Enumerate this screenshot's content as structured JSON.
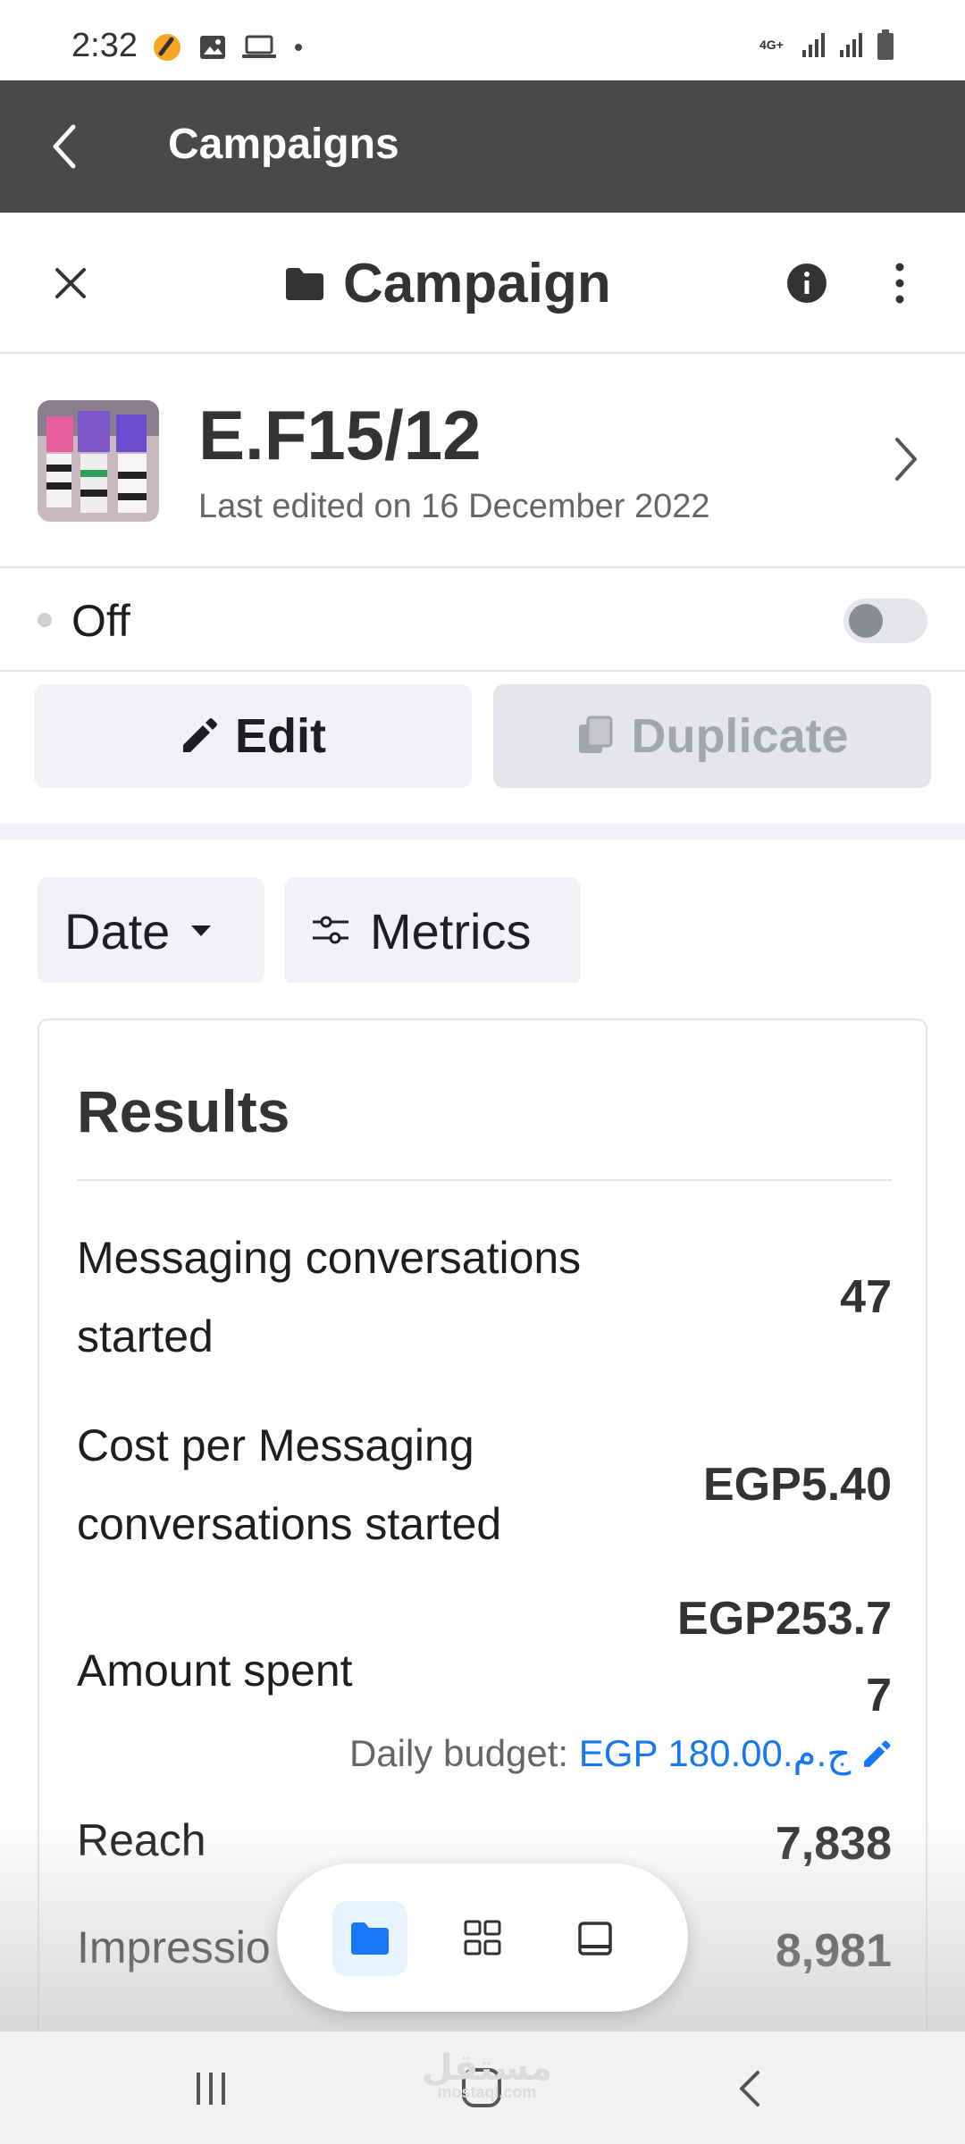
{
  "status_bar": {
    "time": "2:32",
    "network": "4G+"
  },
  "app_bar": {
    "title": "Campaigns"
  },
  "header": {
    "title": "Campaign"
  },
  "campaign": {
    "name": "E.F15/12",
    "last_edited": "Last edited on 16 December 2022"
  },
  "status": {
    "label": "Off",
    "toggle_on": false
  },
  "actions": {
    "edit_label": "Edit",
    "duplicate_label": "Duplicate"
  },
  "filters": {
    "date_label": "Date",
    "metrics_label": "Metrics"
  },
  "results": {
    "title": "Results",
    "rows": [
      {
        "label_line1": "Messaging conversations",
        "label_line2": "started",
        "value": "47"
      },
      {
        "label_line1": "Cost per Messaging",
        "label_line2": "conversations started",
        "value": "EGP5.40"
      },
      {
        "label": "Amount spent",
        "value_line1": "EGP253.7",
        "value_line2": "7"
      },
      {
        "label": "Reach",
        "value": "7,838"
      },
      {
        "label": "Impressio",
        "value": "8,981"
      }
    ],
    "budget_prefix": "Daily budget: ",
    "budget_value": "EGP 180.00.ج.م"
  },
  "watermark": {
    "text": "مستقل",
    "sub": "mostaql.com"
  },
  "colors": {
    "app_bar": "#48494b",
    "accent": "#1877f2"
  }
}
